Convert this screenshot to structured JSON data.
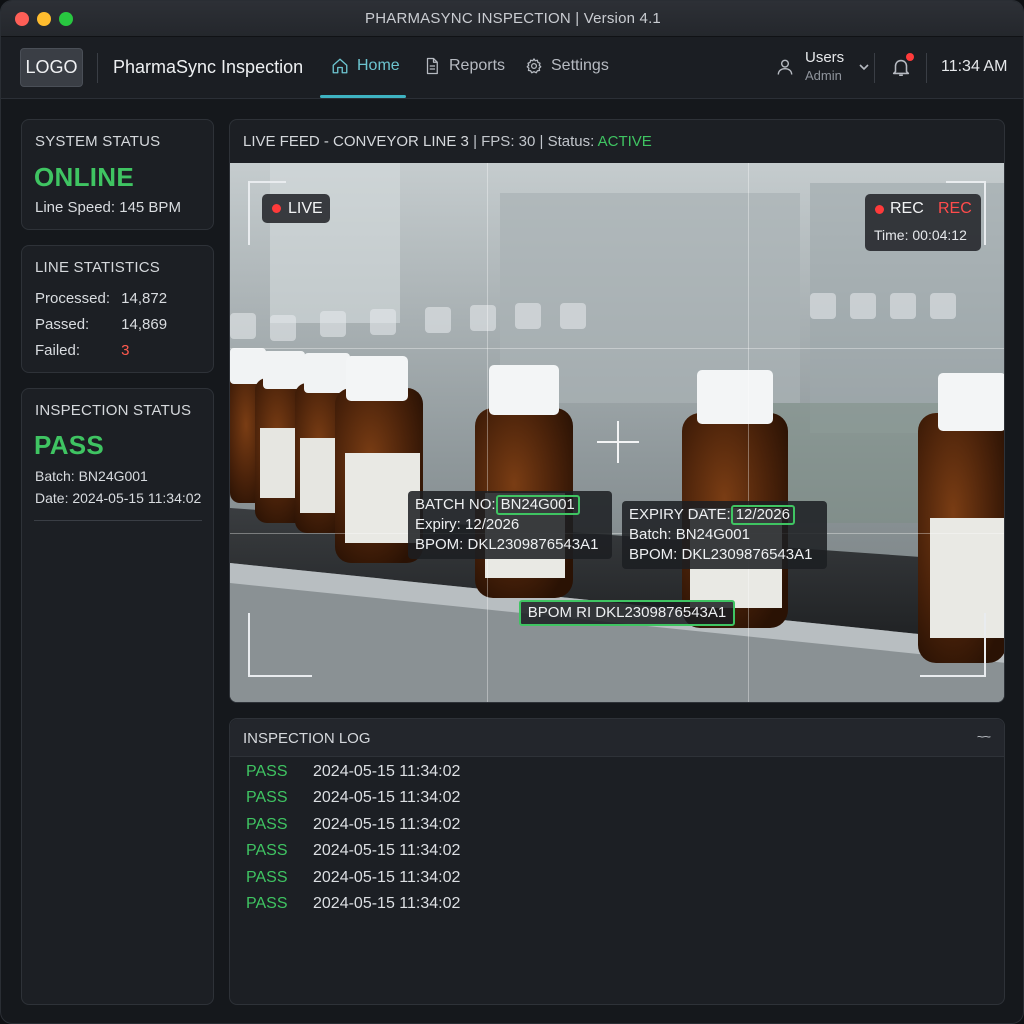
{
  "window": {
    "title": "PHARMASYNC INSPECTION | Version 4.1"
  },
  "header": {
    "logo": "LOGO",
    "app_name": "PharmaSync Inspection",
    "nav": [
      {
        "label": "Home",
        "icon": "home-icon",
        "active": true
      },
      {
        "label": "Reports",
        "icon": "document-icon",
        "active": false
      },
      {
        "label": "Settings",
        "icon": "gear-icon",
        "active": false
      }
    ],
    "user": {
      "name": "Users",
      "role": "Admin"
    },
    "clock": "11:34 AM",
    "colors": {
      "accent": "#3eb3c2",
      "notification": "#ff3b3b"
    }
  },
  "system_status": {
    "title": "SYSTEM STATUS",
    "status": "ONLINE",
    "line_speed": "Line Speed: 145 BPM"
  },
  "line_statistics": {
    "title": "LINE STATISTICS",
    "rows": [
      {
        "label": "Processed:",
        "value": "14,872"
      },
      {
        "label": "Passed:",
        "value": "14,869"
      },
      {
        "label": "Failed:",
        "value": "3"
      }
    ]
  },
  "inspection_status": {
    "title": "INSPECTION STATUS",
    "status": "PASS",
    "batch": "Batch: BN24G001",
    "date": "Date: 2024-05-15 11:34:02"
  },
  "live_feed": {
    "title": "LIVE FEED - CONVEYOR LINE 3",
    "fps": "| FPS: 30 | Status:",
    "status": "ACTIVE",
    "live_label": "LIVE",
    "rec_label": "REC",
    "rec_label_red": "REC",
    "rec_time": "Time: 00:04:12",
    "ocr_left": {
      "batch_label": "BATCH NO:",
      "batch_value": "BN24G001",
      "expiry": "Expiry: 12/2026",
      "bpom": "BPOM: DKL2309876543A1"
    },
    "ocr_right": {
      "expiry_label": "EXPIRY DATE:",
      "expiry_value": "12/2026",
      "batch": "Batch: BN24G001",
      "bpom": "BPOM: DKL2309876543A1"
    },
    "ocr_center": "BPOM RI DKL2309876543A1",
    "colors": {
      "ok": "#3fc462",
      "rec": "#ff4b4b"
    }
  },
  "inspection_log": {
    "title": "INSPECTION LOG",
    "menu": "~~",
    "rows": [
      {
        "status": "PASS",
        "time": "2024-05-15 11:34:02"
      },
      {
        "status": "PASS",
        "time": "2024-05-15 11:34:02"
      },
      {
        "status": "PASS",
        "time": "2024-05-15 11:34:02"
      },
      {
        "status": "PASS",
        "time": "2024-05-15 11:34:02"
      },
      {
        "status": "PASS",
        "time": "2024-05-15 11:34:02"
      },
      {
        "status": "PASS",
        "time": "2024-05-15 11:34:02"
      }
    ]
  }
}
